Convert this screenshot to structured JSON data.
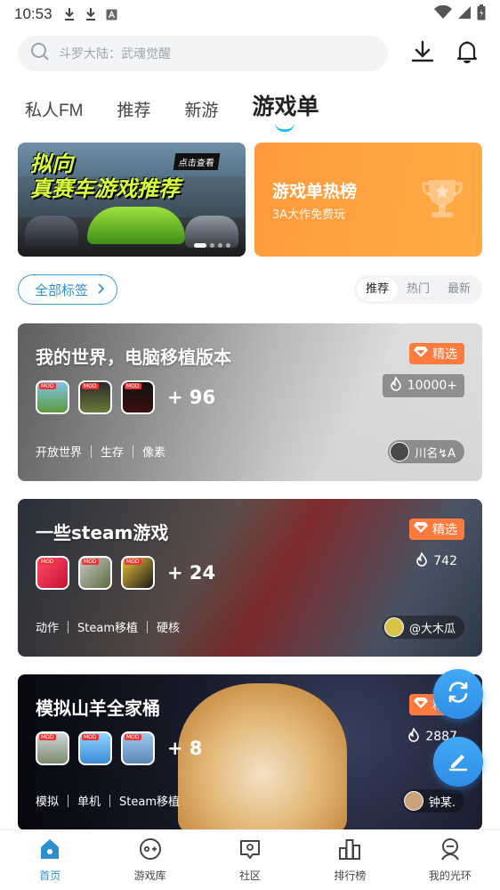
{
  "status_bar": {
    "time": "10:53"
  },
  "search": {
    "placeholder": "斗罗大陆：武魂觉醒"
  },
  "tabs": [
    {
      "label": "私人FM",
      "active": false
    },
    {
      "label": "推荐",
      "active": false
    },
    {
      "label": "新游",
      "active": false
    },
    {
      "label": "游戏单",
      "active": true
    }
  ],
  "banner_left": {
    "headline_1": "拟向",
    "headline_2": "真赛车游戏推荐",
    "badge": "点击查看"
  },
  "banner_right": {
    "title": "游戏单热榜",
    "subtitle": "3A大作免费玩"
  },
  "filter": {
    "all_tags_label": "全部标签",
    "sort_options": [
      {
        "label": "推荐",
        "active": true
      },
      {
        "label": "热门",
        "active": false
      },
      {
        "label": "最新",
        "active": false
      }
    ]
  },
  "cards": [
    {
      "title": "我的世界，电脑移植版本",
      "more": "+ 96",
      "choice_label": "精选",
      "heat": "10000+",
      "tags": [
        "开放世界",
        "生存",
        "像素"
      ],
      "author": "川名↯A"
    },
    {
      "title": "一些steam游戏",
      "more": "+ 24",
      "choice_label": "精选",
      "heat": "742",
      "tags": [
        "动作",
        "Steam移植",
        "硬核"
      ],
      "author": "@大木瓜"
    },
    {
      "title": "模拟山羊全家桶",
      "more": "+ 8",
      "choice_label": "精选",
      "heat": "2887",
      "tags": [
        "模拟",
        "单机",
        "Steam移植"
      ],
      "author": "钟某."
    }
  ],
  "bottom_nav": [
    {
      "label": "首页",
      "active": true
    },
    {
      "label": "游戏库",
      "active": false
    },
    {
      "label": "社区",
      "active": false
    },
    {
      "label": "排行榜",
      "active": false
    },
    {
      "label": "我的光环",
      "active": false
    }
  ],
  "colors": {
    "accent": "#2c8fd0",
    "orange": "#ff9a3d",
    "fab": "#3a9cf0",
    "tab_underline": "#21c1ec"
  },
  "icons": [
    "search-icon",
    "download-icon",
    "bell-icon",
    "trophy-icon",
    "refresh-icon",
    "edit-icon",
    "fire-icon",
    "diamond-icon"
  ]
}
